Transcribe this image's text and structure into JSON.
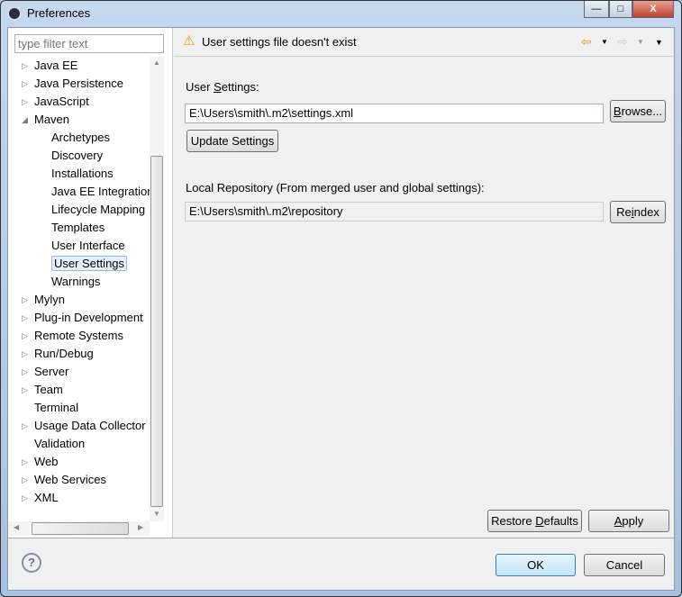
{
  "window": {
    "title": "Preferences",
    "minimize": "—",
    "maximize": "□",
    "close": "X"
  },
  "filter": {
    "placeholder": "type filter text"
  },
  "tree": [
    {
      "label": "Java EE",
      "level": 0,
      "arrow": "right"
    },
    {
      "label": "Java Persistence",
      "level": 0,
      "arrow": "right"
    },
    {
      "label": "JavaScript",
      "level": 0,
      "arrow": "right"
    },
    {
      "label": "Maven",
      "level": 0,
      "arrow": "down"
    },
    {
      "label": "Archetypes",
      "level": 1
    },
    {
      "label": "Discovery",
      "level": 1
    },
    {
      "label": "Installations",
      "level": 1
    },
    {
      "label": "Java EE Integration",
      "level": 1
    },
    {
      "label": "Lifecycle Mapping",
      "level": 1
    },
    {
      "label": "Templates",
      "level": 1
    },
    {
      "label": "User Interface",
      "level": 1
    },
    {
      "label": "User Settings",
      "level": 1,
      "selected": true
    },
    {
      "label": "Warnings",
      "level": 1
    },
    {
      "label": "Mylyn",
      "level": 0,
      "arrow": "right"
    },
    {
      "label": "Plug-in Development",
      "level": 0,
      "arrow": "right"
    },
    {
      "label": "Remote Systems",
      "level": 0,
      "arrow": "right"
    },
    {
      "label": "Run/Debug",
      "level": 0,
      "arrow": "right"
    },
    {
      "label": "Server",
      "level": 0,
      "arrow": "right"
    },
    {
      "label": "Team",
      "level": 0,
      "arrow": "right"
    },
    {
      "label": "Terminal",
      "level": 0
    },
    {
      "label": "Usage Data Collector",
      "level": 0,
      "arrow": "right"
    },
    {
      "label": "Validation",
      "level": 0
    },
    {
      "label": "Web",
      "level": 0,
      "arrow": "right"
    },
    {
      "label": "Web Services",
      "level": 0,
      "arrow": "right"
    },
    {
      "label": "XML",
      "level": 0,
      "arrow": "right"
    }
  ],
  "header": {
    "message": "User settings file doesn't exist",
    "icon": "warning-icon"
  },
  "main": {
    "user_settings_label_pre": "User ",
    "user_settings_label_u": "S",
    "user_settings_label_post": "ettings:",
    "user_settings_value": "E:\\Users\\smith\\.m2\\settings.xml",
    "browse_u": "B",
    "browse_rest": "rowse...",
    "update_settings": "Update Settings",
    "local_repo_label": "Local Repository (From merged user and global settings):",
    "local_repo_value": "E:\\Users\\smith\\.m2\\repository",
    "reindex_pre": "Re",
    "reindex_u": "i",
    "reindex_post": "ndex",
    "restore_pre": "Restore ",
    "restore_u": "D",
    "restore_post": "efaults",
    "apply_u": "A",
    "apply_post": "pply"
  },
  "footer": {
    "ok": "OK",
    "cancel": "Cancel",
    "help_icon": "?"
  }
}
